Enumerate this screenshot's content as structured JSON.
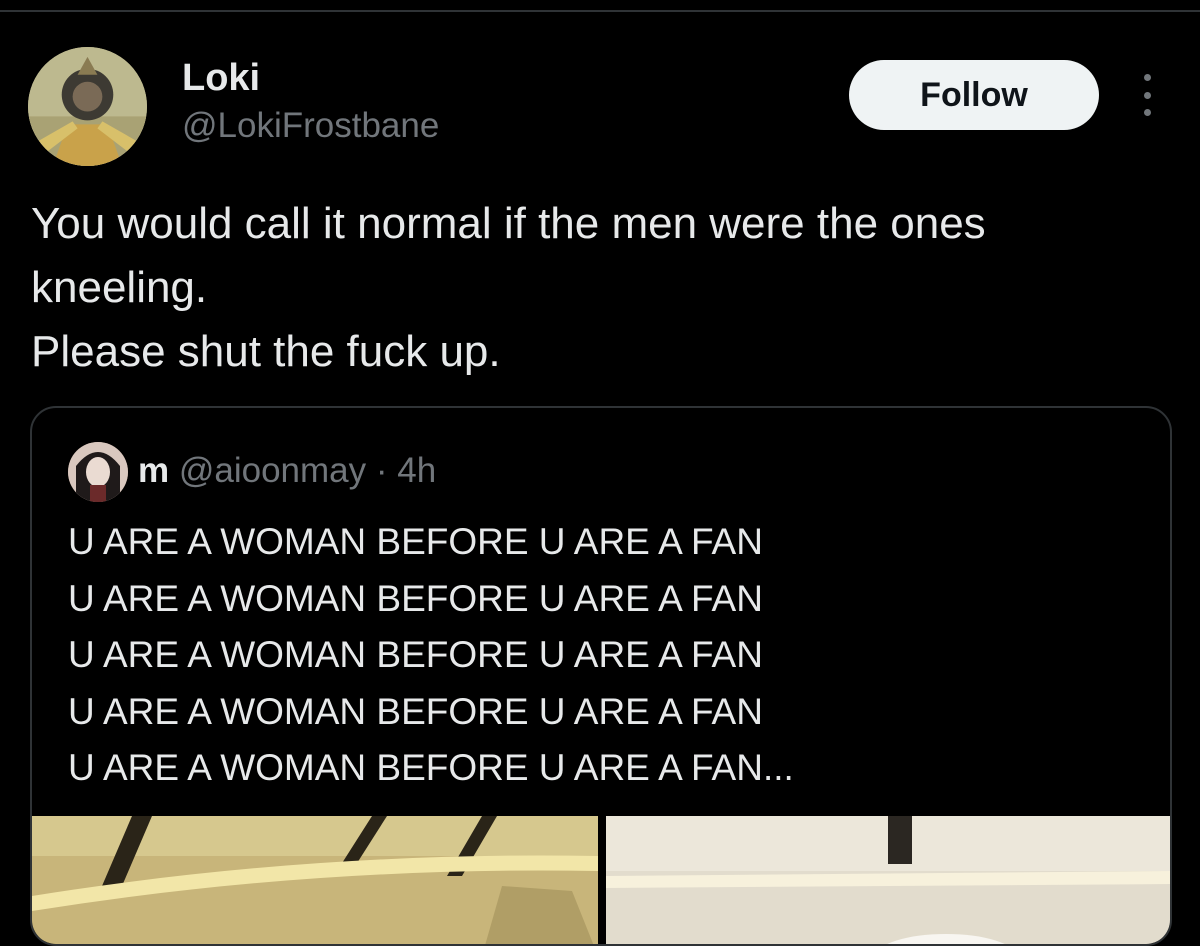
{
  "tweet": {
    "author": {
      "display_name": "Loki",
      "handle": "@LokiFrostbane",
      "avatar_icon": "avatar-image"
    },
    "follow_label": "Follow",
    "more_icon": "more-options-icon",
    "text_lines": [
      "You would call it normal if the men were the ones",
      "kneeling.",
      "Please shut the fuck up."
    ]
  },
  "quote": {
    "author": {
      "display_name": "m",
      "handle": "@aioonmay",
      "separator": "·",
      "time": "4h",
      "avatar_icon": "avatar-image"
    },
    "text_lines": [
      "U ARE A WOMAN BEFORE U ARE A FAN",
      "U ARE A WOMAN BEFORE U ARE A FAN",
      "U ARE A WOMAN BEFORE U ARE A FAN",
      "U ARE A WOMAN BEFORE U ARE A FAN",
      "U ARE A WOMAN BEFORE U ARE A FAN..."
    ],
    "media": [
      "photo",
      "photo"
    ]
  },
  "colors": {
    "background": "#000000",
    "primary_text": "#e7e9ea",
    "secondary_text": "#71767b",
    "border": "#2f3336",
    "follow_bg": "#eff3f4",
    "follow_text": "#0f1419"
  }
}
